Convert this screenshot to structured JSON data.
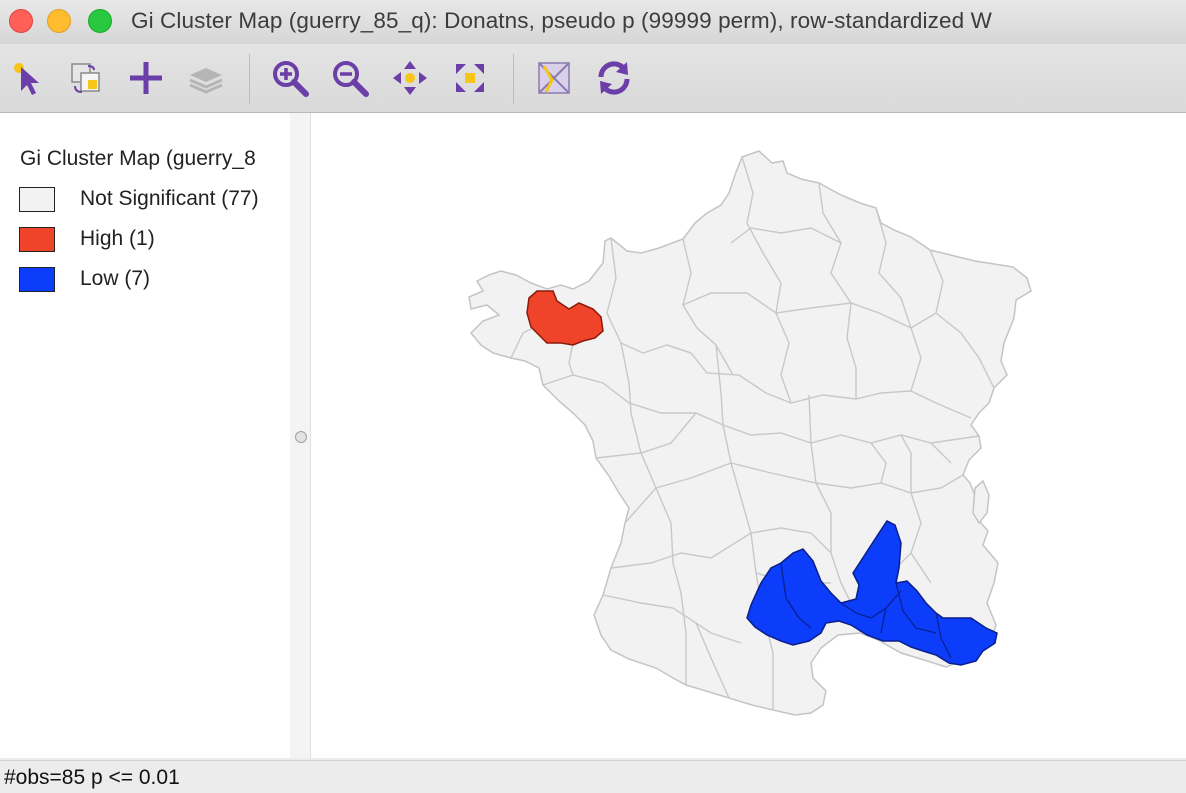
{
  "window": {
    "title": "Gi Cluster Map (guerry_85_q): Donatns, pseudo p (99999 perm), row-standardized W"
  },
  "toolbar": {
    "buttons": [
      {
        "icon": "select-pointer-icon"
      },
      {
        "icon": "copy-map-icon"
      },
      {
        "icon": "add-layer-icon"
      },
      {
        "icon": "layers-icon"
      },
      {
        "icon": "zoom-in-icon"
      },
      {
        "icon": "zoom-out-icon"
      },
      {
        "icon": "pan-icon"
      },
      {
        "icon": "full-extent-icon"
      },
      {
        "icon": "selection-map-icon"
      },
      {
        "icon": "refresh-icon"
      }
    ]
  },
  "legend": {
    "title": "Gi Cluster Map (guerry_8",
    "items": [
      {
        "label": "Not Significant (77)",
        "color": "#f2f2f2"
      },
      {
        "label": "High (1)",
        "color": "#f0442a"
      },
      {
        "label": "Low (7)",
        "color": "#0b3dfa"
      }
    ]
  },
  "map": {
    "base_color": "#f2f2f2",
    "border_color": "#c4c4c4",
    "high_color": "#f0442a",
    "low_color": "#0b3dfa"
  },
  "status": {
    "text": "#obs=85  p <= 0.01"
  }
}
